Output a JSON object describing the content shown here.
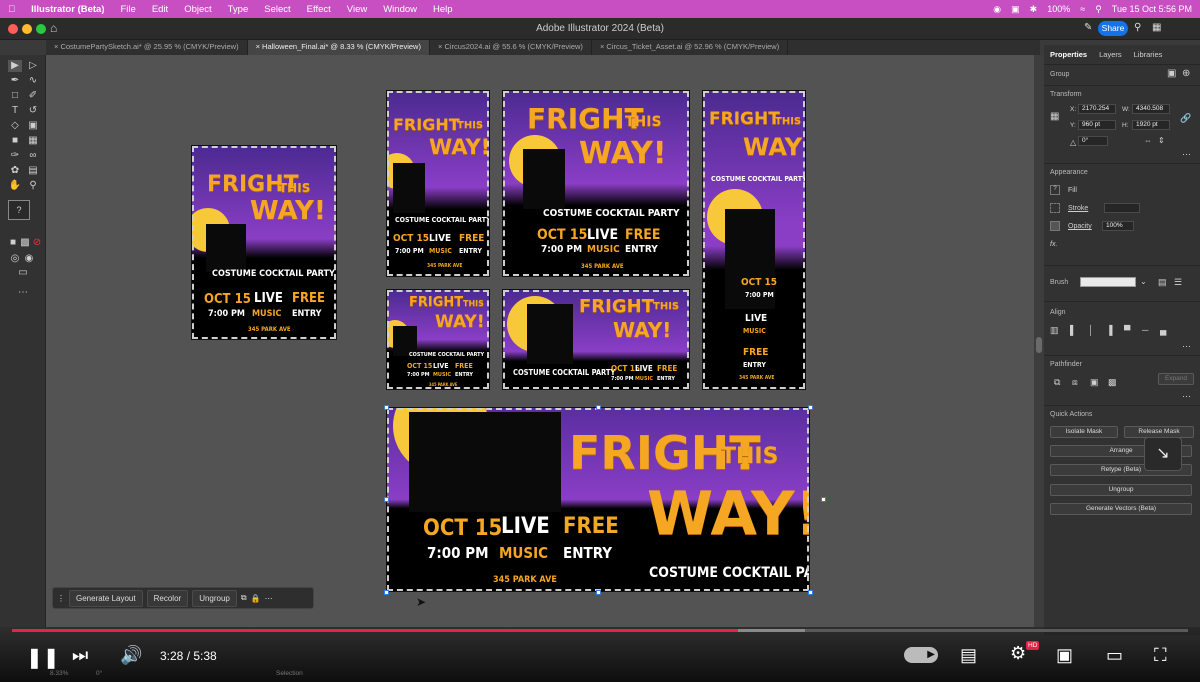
{
  "menubar": {
    "app_name": "Illustrator (Beta)",
    "items": [
      "File",
      "Edit",
      "Object",
      "Type",
      "Select",
      "Effect",
      "View",
      "Window",
      "Help"
    ],
    "battery": "100%",
    "clock": "Tue 15 Oct  5:56 PM"
  },
  "window": {
    "title": "Adobe Illustrator 2024 (Beta)",
    "share_label": "Share"
  },
  "doc_tabs": [
    {
      "label": "CostumePartySketch.ai* @ 25.95 % (CMYK/Preview)"
    },
    {
      "label": "Halloween_Final.ai* @ 8.33 % (CMYK/Preview)"
    },
    {
      "label": "Circus2024.ai @ 55.6 % (CMYK/Preview)"
    },
    {
      "label": "Circus_Ticket_Asset.ai @ 52.96 % (CMYK/Preview)"
    }
  ],
  "panel": {
    "tabs": [
      "Properties",
      "Layers",
      "Libraries"
    ],
    "group_label": "Group",
    "transform": {
      "title": "Transform",
      "x": "2170.254",
      "w": "4340.508",
      "y": "960 pt",
      "h": "1920 pt",
      "angle": "0°",
      "x_label": "X:",
      "y_label": "Y:",
      "w_label": "W:",
      "h_label": "H:"
    },
    "appearance": {
      "title": "Appearance",
      "fill": "Fill",
      "stroke": "Stroke",
      "opacity": "Opacity",
      "opacity_value": "100%",
      "fx": "fx."
    },
    "brush": {
      "label": "Brush"
    },
    "align": {
      "title": "Align"
    },
    "pathfinder": {
      "title": "Pathfinder",
      "expand": "Expand"
    },
    "quick_actions": {
      "title": "Quick Actions",
      "isolate": "Isolate Mask",
      "release": "Release Mask",
      "arrange": "Arrange",
      "retype": "Retype (Beta)",
      "ungroup": "Ungroup",
      "generate": "Generate Vectors (Beta)"
    }
  },
  "poster": {
    "fright": "FRIGHT",
    "this": "THIS",
    "way": "WAY!",
    "party": "COSTUME COCKTAIL PARTY",
    "date": "OCT 15",
    "time": "7:00 PM",
    "live": "LIVE",
    "music": "MUSIC",
    "free": "FREE",
    "entry": "ENTRY",
    "address": "345 PARK AVE"
  },
  "contextbar": {
    "generate_layout": "Generate Layout",
    "recolor": "Recolor",
    "ungroup": "Ungroup"
  },
  "player": {
    "time": "3:28 / 5:38",
    "hd_badge": "HD",
    "progress": 0.617,
    "buffered": 0.674
  },
  "status": {
    "zoom": "8.33%",
    "angle": "0°",
    "selection": "Selection"
  },
  "colors": {
    "menubar": "#c74fc2",
    "accent_orange": "#f5a623",
    "progress_red": "#e52247",
    "share_blue": "#1473e6"
  }
}
